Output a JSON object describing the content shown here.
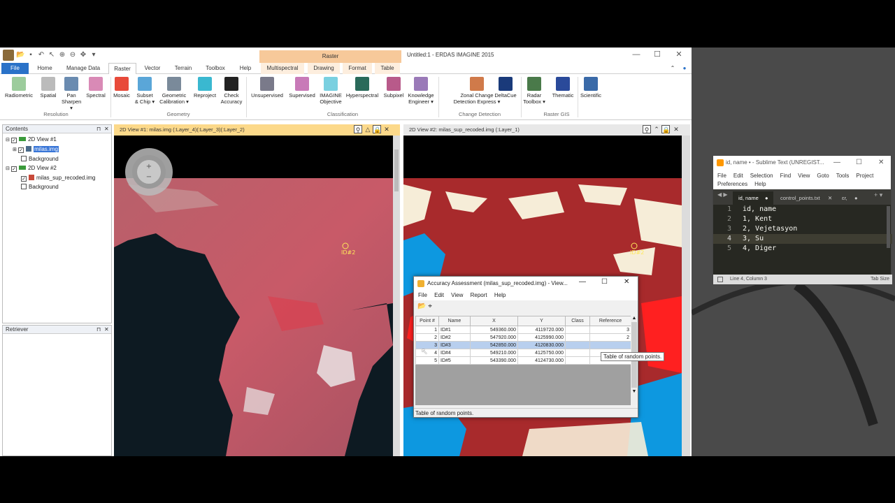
{
  "erdas": {
    "title": "Untitled:1 - ERDAS IMAGINE 2015",
    "context_tab": "Raster",
    "tabs": [
      "File",
      "Home",
      "Manage Data",
      "Raster",
      "Vector",
      "Terrain",
      "Toolbox",
      "Help",
      "Multispectral",
      "Drawing",
      "Format",
      "Table"
    ],
    "ribbon": {
      "buttons": [
        {
          "label": "Radiometric",
          "color": "#9ccc9c"
        },
        {
          "label": "Spatial",
          "color": "#bbbbbb"
        },
        {
          "label": "Pan\nSharpen ▾",
          "color": "#6a8bb0"
        },
        {
          "label": "Spectral",
          "color": "#d98ab6"
        },
        {
          "label": "Mosaic",
          "color": "#e84a3a"
        },
        {
          "label": "Subset\n& Chip ▾",
          "color": "#5aa6d8"
        },
        {
          "label": "Geometric\nCalibration ▾",
          "color": "#7a8a9a"
        },
        {
          "label": "Reproject",
          "color": "#3ab8d0"
        },
        {
          "label": "Check\nAccuracy",
          "color": "#222222"
        },
        {
          "label": "Unsupervised",
          "color": "#7a7a8a"
        },
        {
          "label": "Supervised",
          "color": "#c87ab8"
        },
        {
          "label": "IMAGINE\nObjective",
          "color": "#7ad0e0"
        },
        {
          "label": "Hyperspectral",
          "color": "#2a6a5a"
        },
        {
          "label": "Subpixel",
          "color": "#b85a8a"
        },
        {
          "label": "Knowledge\nEngineer ▾",
          "color": "#9a7ab8"
        },
        {
          "label": "Zonal Change\nDetection Express ▾",
          "color": "#d07a4a"
        },
        {
          "label": "DeltaCue",
          "color": "#1a3a7a"
        },
        {
          "label": "Radar\nToolbox ▾",
          "color": "#4a7a4a"
        },
        {
          "label": "Thematic",
          "color": "#2a4a9a"
        },
        {
          "label": "Scientific",
          "color": "#3a6aa8"
        }
      ],
      "groups": [
        "Resolution",
        "Geometry",
        "Classification",
        "Change Detection",
        "Raster GIS"
      ]
    },
    "contents": {
      "title": "Contents",
      "items": [
        "2D View #1",
        "milas.img",
        "Background",
        "2D View #2",
        "milas_sup_recoded.img",
        "Background"
      ]
    },
    "retriever": {
      "title": "Retriever"
    },
    "view1": {
      "title": "2D View #1: milas.img (:Layer_4)(:Layer_3)(:Layer_2)"
    },
    "view2": {
      "title": "2D View #2: milas_sup_recoded.img (:Layer_1)"
    },
    "point_labels": {
      "view1": "ID#2",
      "view2": "ID#2"
    }
  },
  "accuracy": {
    "title": "Accuracy Assessment (milas_sup_recoded.img) - View...",
    "menu": [
      "File",
      "Edit",
      "View",
      "Report",
      "Help"
    ],
    "columns": [
      "Point #",
      "Name",
      "X",
      "Y",
      "Class",
      "Reference"
    ],
    "rows": [
      [
        "1",
        "ID#1",
        "549360.000",
        "4119720.000",
        "",
        "3"
      ],
      [
        "2",
        "ID#2",
        "547920.000",
        "4125990.000",
        "",
        "2"
      ],
      [
        "3",
        "ID#3",
        "542850.000",
        "4120830.000",
        "",
        ""
      ],
      [
        "4",
        "ID#4",
        "549210.000",
        "4125750.000",
        "",
        ""
      ],
      [
        "5",
        "ID#5",
        "543390.000",
        "4124730.000",
        "",
        ""
      ]
    ],
    "selected_row": 2,
    "tooltip": "Table of random points.",
    "status": "Table of random points."
  },
  "sublime": {
    "title": "id, name • - Sublime Text (UNREGIST...",
    "menu_row1": [
      "File",
      "Edit",
      "Selection",
      "Find",
      "View",
      "Goto",
      "Tools",
      "Project"
    ],
    "menu_row2": [
      "Preferences",
      "Help"
    ],
    "tabs": [
      "id, name",
      "control_points.txt",
      "ɛr,"
    ],
    "lines": [
      "id, name",
      "1, Kent",
      "2, Vejetasyon",
      "3, Su",
      "4, Diger"
    ],
    "active_line": 4,
    "status_left": "Line 4, Column 3",
    "status_right": "Tab Size"
  }
}
